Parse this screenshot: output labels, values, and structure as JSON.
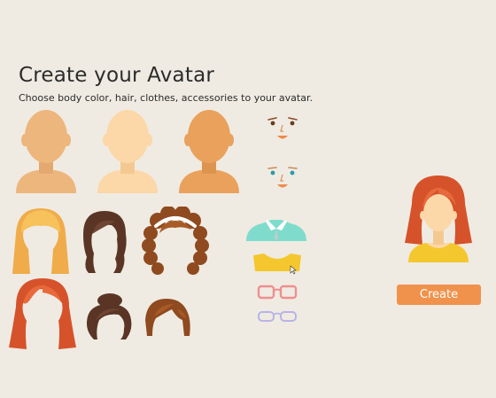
{
  "header": {
    "title": "Create your Avatar",
    "subtitle": "Choose body color, hair, clothes, accessories to your avatar."
  },
  "actions": {
    "create_label": "Create"
  },
  "colors": {
    "background": "#efebe2",
    "button": "#f0924c",
    "skin_1": "#edb67c",
    "skin_2": "#fcd7a8",
    "skin_3": "#e9a15c",
    "hair_blonde": "#f0ac4a",
    "hair_dark": "#5a3525",
    "hair_brown": "#8f4a1f",
    "hair_red": "#d6522a",
    "shirt_teal": "#7fdccc",
    "shirt_yellow": "#f5c72e",
    "glasses_pink": "#ef8f8f",
    "glasses_lilac": "#b9b3e8"
  }
}
